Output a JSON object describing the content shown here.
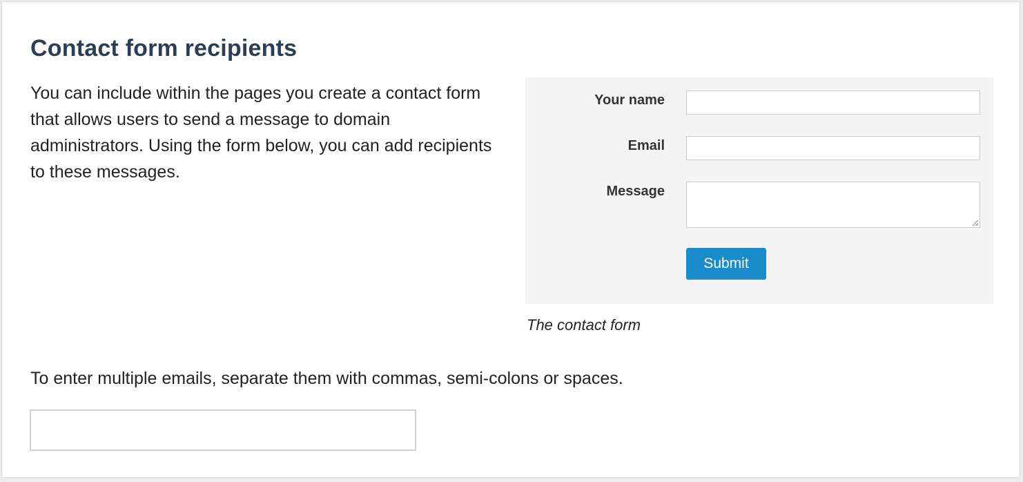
{
  "title": "Contact form recipients",
  "intro": "You can include within the pages you create a contact form that allows users to send a message to domain administrators. Using the form below, you can add recipients to these messages.",
  "preview": {
    "name_label": "Your name",
    "email_label": "Email",
    "message_label": "Message",
    "submit_label": "Submit",
    "caption": "The contact form"
  },
  "hint": "To enter multiple emails, separate them with commas, semi-colons or spaces.",
  "recipients_value": "",
  "colors": {
    "heading": "#2c3e55",
    "submit": "#1b8ccb",
    "preview_bg": "#f4f4f4"
  }
}
